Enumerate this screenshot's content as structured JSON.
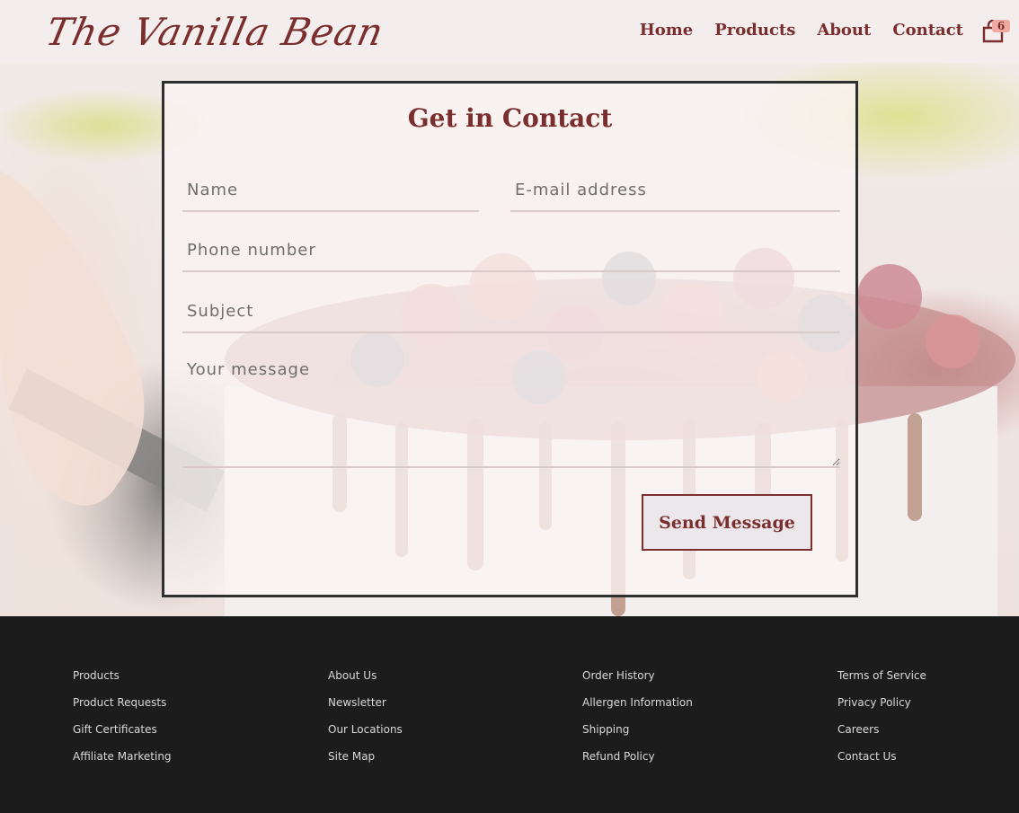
{
  "header": {
    "logo_text": "The Vanilla Bean",
    "nav": [
      {
        "label": "Home"
      },
      {
        "label": "Products"
      },
      {
        "label": "About"
      },
      {
        "label": "Contact"
      }
    ],
    "cart_count": "6",
    "cart_icon": "shopping-bag-icon"
  },
  "contact_form": {
    "title": "Get in Contact",
    "name_placeholder": "Name",
    "email_placeholder": "E-mail address",
    "phone_placeholder": "Phone number",
    "subject_placeholder": "Subject",
    "message_placeholder": "Your message",
    "submit_label": "Send Message"
  },
  "footer": {
    "columns": [
      {
        "links": [
          "Products",
          "Product Requests",
          "Gift Certificates",
          "Affiliate Marketing"
        ]
      },
      {
        "links": [
          "About Us",
          "Newsletter",
          "Our Locations",
          "Site Map"
        ]
      },
      {
        "links": [
          "Order History",
          "Allergen Information",
          "Shipping",
          "Refund Policy"
        ]
      },
      {
        "links": [
          "Terms of Service",
          "Privacy Policy",
          "Careers",
          "Contact Us"
        ]
      }
    ]
  },
  "colors": {
    "brand": "#7a2e2e",
    "header_bg": "#f4eded",
    "footer_bg": "#1c1c1c",
    "badge": "#f0a9a0"
  }
}
